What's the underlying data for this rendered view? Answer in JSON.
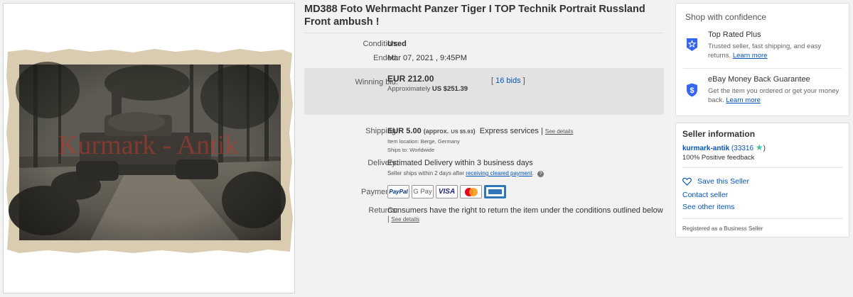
{
  "title": "MD388 Foto Wehrmacht Panzer Tiger I TOP Technik Portrait Russland Front ambush !",
  "image": {
    "watermark": "Kurmark - Antik"
  },
  "details": {
    "condition_label": "Condition:",
    "condition_value": "Used",
    "ended_label": "Ended:",
    "ended_value": "Mar 07, 2021 , 9:45PM",
    "winning_bid_label": "Winning bid:",
    "winning_bid_value": "EUR 212.00",
    "approx_prefix": "Approximately",
    "approx_value": "US $251.39",
    "bids_link": "16 bids",
    "bids_open": "[",
    "bids_close": "]"
  },
  "shipping": {
    "label": "Shipping:",
    "price": "EUR 5.00",
    "approx_open": "(approx.",
    "approx_value": "US $5.93",
    "approx_close": ")",
    "service": "Express services",
    "separator": "|",
    "see_details": "See details",
    "item_location": "Item location:  Berge, Germany",
    "ships_to": "Ships to:  Worldwide"
  },
  "delivery": {
    "label": "Delivery:",
    "estimate": "Estimated Delivery within 3 business days",
    "note_prefix": "Seller ships within 2 days after",
    "note_link": "receiving cleared payment",
    "note_suffix": "."
  },
  "payments": {
    "label": "Payments:",
    "methods": [
      "PayPal",
      "G Pay",
      "VISA",
      "Mastercard",
      "AMEX"
    ]
  },
  "returns": {
    "label": "Returns:",
    "text": "Consumers have the right to return the item under the conditions outlined below",
    "separator": "|",
    "see_details": "See details"
  },
  "confidence": {
    "title": "Shop with confidence",
    "items": [
      {
        "icon": "top-rated-star-icon",
        "heading": "Top Rated Plus",
        "text": "Trusted seller, fast shipping, and easy returns.",
        "link": "Learn more"
      },
      {
        "icon": "money-back-shield-icon",
        "heading": "eBay Money Back Guarantee",
        "text": "Get the item you ordered or get your money back.",
        "link": "Learn more"
      }
    ]
  },
  "seller": {
    "title": "Seller information",
    "name": "kurmark-antik",
    "score_open": "(33316",
    "score_close": ")",
    "feedback": "100% Positive feedback",
    "save": "Save this Seller",
    "contact": "Contact seller",
    "other_items": "See other items",
    "registered": "Registered as a Business Seller"
  },
  "colors": {
    "link": "#0654ba",
    "shield_blue": "#3665f3",
    "bid_box": "#e2e2e2"
  }
}
